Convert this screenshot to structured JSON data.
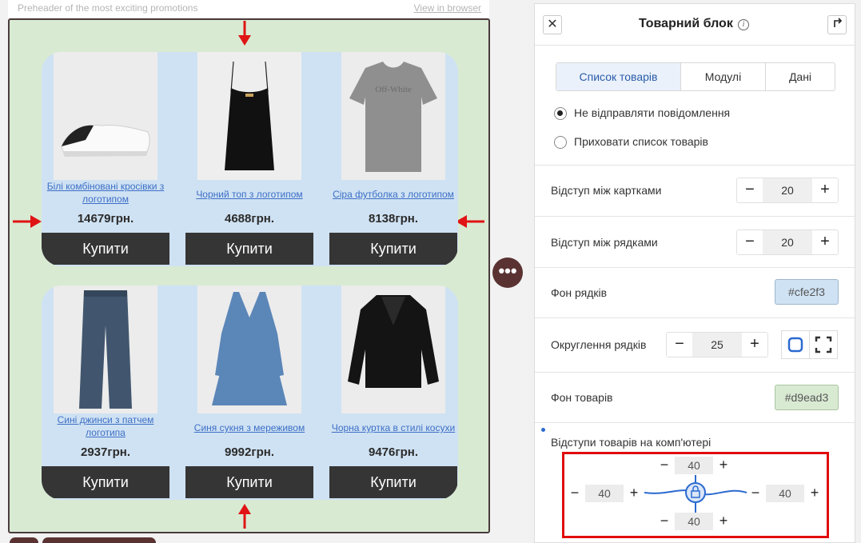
{
  "preheader": {
    "text": "Preheader of the most exciting promotions",
    "view_link": "View in browser"
  },
  "products": [
    {
      "name": "Білі комбіновані кросівки з логотипом",
      "price": "14679грн.",
      "buy": "Купити",
      "icon": "sneaker-image"
    },
    {
      "name": "Чорний топ з логотипом",
      "price": "4688грн.",
      "buy": "Купити",
      "icon": "black-top-image"
    },
    {
      "name": "Сіра футболка з логотипом",
      "price": "8138грн.",
      "buy": "Купити",
      "icon": "grey-tshirt-image"
    },
    {
      "name": "Сині джинси з патчем логотипа",
      "price": "2937грн.",
      "buy": "Купити",
      "icon": "jeans-image"
    },
    {
      "name": "Синя сукня з мереживом",
      "price": "9992грн.",
      "buy": "Купити",
      "icon": "blue-dress-image"
    },
    {
      "name": "Чорна куртка в стилі косухи",
      "price": "9476грн.",
      "buy": "Купити",
      "icon": "leather-jacket-image"
    }
  ],
  "panel": {
    "title": "Товарний блок",
    "close_icon": "close-icon",
    "info_icon": "info-icon",
    "collapse_icon": "collapse-icon",
    "tabs": [
      "Список товарів",
      "Модулі",
      "Дані"
    ],
    "radio_options": [
      {
        "label": "Не відправляти повідомлення",
        "checked": true
      },
      {
        "label": "Приховати список товарів",
        "checked": false
      }
    ],
    "card_gap": {
      "label": "Відступ між картками",
      "value": "20"
    },
    "row_gap": {
      "label": "Відступ між рядками",
      "value": "20"
    },
    "row_bg": {
      "label": "Фон рядків",
      "value": "#cfe2f3"
    },
    "row_radius": {
      "label": "Округлення рядків",
      "value": "25"
    },
    "product_bg": {
      "label": "Фон товарів",
      "value": "#d9ead3"
    },
    "padding": {
      "label": "Відступи товарів на комп'ютері",
      "top": "40",
      "left": "40",
      "right": "40",
      "bottom": "40"
    }
  },
  "colors": {
    "row_bg": "#cfe2f3",
    "block_bg": "#d9ead3",
    "accent_red": "#e00c0c",
    "button_dark": "#353535"
  }
}
